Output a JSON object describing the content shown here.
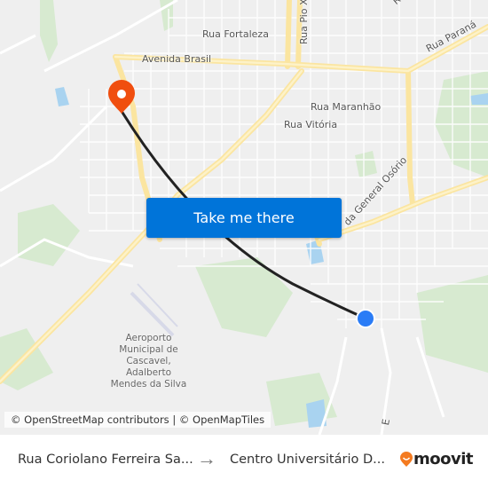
{
  "map": {
    "street_labels": [
      {
        "id": "rua-fortaleza",
        "text": "Rua Fortaleza"
      },
      {
        "id": "avenida-brasil",
        "text": "Avenida Brasil"
      },
      {
        "id": "rua-pio-xii",
        "text": "Rua Pio XII"
      },
      {
        "id": "rua-parana",
        "text": "Rua Paraná"
      },
      {
        "id": "rua-maranhao",
        "text": "Rua Maranhão"
      },
      {
        "id": "rua-vitoria",
        "text": "Rua Vitória"
      },
      {
        "id": "general-osorio",
        "text": "da General Osório"
      },
      {
        "id": "top-right-partial",
        "text": "R"
      },
      {
        "id": "bottom-partial",
        "text": "E"
      }
    ],
    "airport_label": "Aeroporto Municipal de Cascavel, Adalberto Mendes da Silva",
    "cta_label": "Take me there",
    "attribution": "© OpenStreetMap contributors | © OpenMapTiles",
    "colors": {
      "destination_pin": "#f04e0f",
      "origin_dot": "#2a7cf6",
      "route_line": "#222222",
      "cta_bg": "#0074d9",
      "major_road": "#fbe8a6",
      "park": "#cfe6c2",
      "water": "#a9d3f0"
    }
  },
  "footer": {
    "from": "Rua Coriolano Ferreira Sa...",
    "arrow_icon": "arrow-right-icon",
    "to": "Centro Universitário D...",
    "brand": "moovit",
    "brand_color": "#f47b20"
  }
}
